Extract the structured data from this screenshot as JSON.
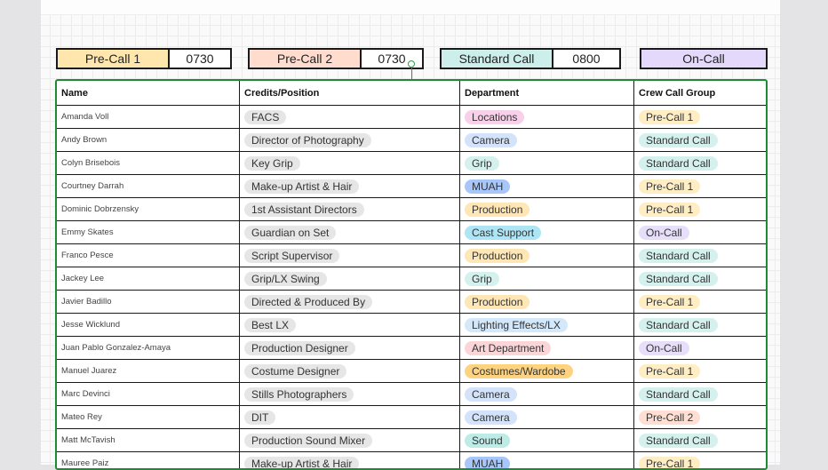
{
  "call_times": [
    {
      "label": "Pre-Call 1",
      "time": "0730",
      "color": "#ffe6ad"
    },
    {
      "label": "Pre-Call 2",
      "time": "0730",
      "color": "#ffdcce"
    },
    {
      "label": "Standard Call",
      "time": "0800",
      "color": "#cdefeb"
    },
    {
      "label": "On-Call",
      "time": "",
      "color": "#e4d9fb"
    }
  ],
  "table": {
    "headers": [
      "Name",
      "Credits/Position",
      "Department",
      "Crew Call Group"
    ],
    "rows": [
      {
        "name": "Amanda Voll",
        "position": "FACS",
        "department": "Locations",
        "dept_color": "#f9d0e9",
        "group": "Pre-Call 1",
        "group_color": "#ffeec4"
      },
      {
        "name": "Andy Brown",
        "position": "Director of Photography",
        "department": "Camera",
        "dept_color": "#d3e3fb",
        "group": "Standard Call",
        "group_color": "#d4f1ee"
      },
      {
        "name": "Colyn Brisebois",
        "position": "Key Grip",
        "department": "Grip",
        "dept_color": "#d4f1ee",
        "group": "Standard Call",
        "group_color": "#d4f1ee"
      },
      {
        "name": "Courtney Darrah",
        "position": "Make-up Artist & Hair",
        "department": "MUAH",
        "dept_color": "#a7c7fb",
        "group": "Pre-Call 1",
        "group_color": "#ffeec4"
      },
      {
        "name": "Dominic Dobrzensky",
        "position": "1st Assistant Directors",
        "department": "Production",
        "dept_color": "#ffe6b5",
        "group": "Pre-Call 1",
        "group_color": "#ffeec4"
      },
      {
        "name": "Emmy Skates",
        "position": "Guardian on Set",
        "department": "Cast Support",
        "dept_color": "#aee5f5",
        "group": "On-Call",
        "group_color": "#e7defa"
      },
      {
        "name": "Franco Pesce",
        "position": "Script Supervisor",
        "department": "Production",
        "dept_color": "#ffe6b5",
        "group": "Standard Call",
        "group_color": "#d4f1ee"
      },
      {
        "name": "Jackey Lee",
        "position": "Grip/LX Swing",
        "department": "Grip",
        "dept_color": "#d4f1ee",
        "group": "Standard Call",
        "group_color": "#d4f1ee"
      },
      {
        "name": "Javier Badillo",
        "position": "Directed & Produced By",
        "department": "Production",
        "dept_color": "#ffe6b5",
        "group": "Pre-Call 1",
        "group_color": "#ffeec4"
      },
      {
        "name": "Jesse Wicklund",
        "position": "Best LX",
        "department": "Lighting Effects/LX",
        "dept_color": "#d3e8fb",
        "group": "Standard Call",
        "group_color": "#d4f1ee"
      },
      {
        "name": "Juan Pablo Gonzalez-Amaya",
        "position": "Production Designer",
        "department": "Art Department",
        "dept_color": "#fcd5d8",
        "group": "On-Call",
        "group_color": "#e7defa"
      },
      {
        "name": "Manuel Juarez",
        "position": "Costume Designer",
        "department": "Costumes/Wardobe",
        "dept_color": "#fdd382",
        "group": "Pre-Call 1",
        "group_color": "#ffeec4"
      },
      {
        "name": "Marc Devinci",
        "position": "Stills Photographers",
        "department": "Camera",
        "dept_color": "#d3e3fb",
        "group": "Standard Call",
        "group_color": "#d4f1ee"
      },
      {
        "name": "Mateo Rey",
        "position": "DIT",
        "department": "Camera",
        "dept_color": "#d3e3fb",
        "group": "Pre-Call 2",
        "group_color": "#ffdfd3"
      },
      {
        "name": "Matt McTavish",
        "position": "Production Sound Mixer",
        "department": "Sound",
        "dept_color": "#bdece6",
        "group": "Standard Call",
        "group_color": "#d4f1ee"
      },
      {
        "name": "Mauree Paiz",
        "position": "Make-up Artist & Hair",
        "department": "MUAH",
        "dept_color": "#a7c7fb",
        "group": "Pre-Call 1",
        "group_color": "#ffeec4"
      }
    ],
    "pill_neutral_color": "#e6e6e6"
  }
}
